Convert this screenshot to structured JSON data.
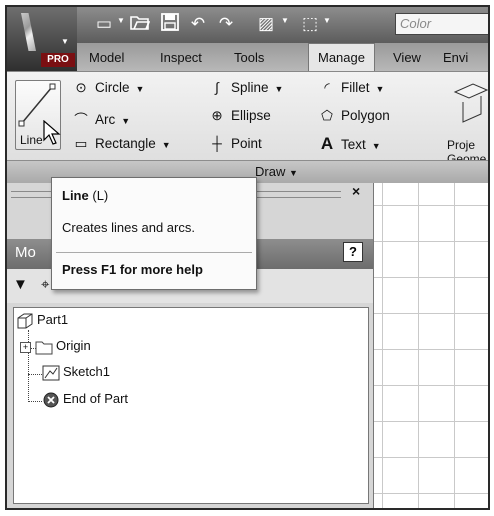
{
  "app": {
    "badge": "PRO",
    "menu_icon": "app-logo-icon"
  },
  "quick_access": {
    "icons": [
      "new-icon",
      "open-icon",
      "save-icon",
      "undo-icon",
      "redo-icon",
      "appearance-icon",
      "select-icon"
    ],
    "color_placeholder": "Color"
  },
  "tabs": [
    {
      "label": "Model"
    },
    {
      "label": "Inspect"
    },
    {
      "label": "Tools"
    },
    {
      "label": "Manage"
    },
    {
      "label": "View"
    },
    {
      "label": "Envi"
    }
  ],
  "ribbon": {
    "line_label": "Line",
    "items": [
      {
        "label": "Circle",
        "icon": "circle-icon",
        "dropdown": true
      },
      {
        "label": "Arc",
        "icon": "arc-icon",
        "dropdown": true
      },
      {
        "label": "Rectangle",
        "icon": "rectangle-icon",
        "dropdown": true
      },
      {
        "label": "Spline",
        "icon": "spline-icon",
        "dropdown": true
      },
      {
        "label": "Ellipse",
        "icon": "ellipse-icon",
        "dropdown": false
      },
      {
        "label": "Point",
        "icon": "point-icon",
        "dropdown": false
      },
      {
        "label": "Fillet",
        "icon": "fillet-icon",
        "dropdown": true
      },
      {
        "label": "Polygon",
        "icon": "polygon-icon",
        "dropdown": false
      },
      {
        "label": "Text",
        "icon": "text-icon",
        "dropdown": true
      }
    ],
    "project_label_1": "Proje",
    "project_label_2": "Geome",
    "panel_title": "Draw"
  },
  "tooltip": {
    "title": "Line",
    "shortcut": "(L)",
    "description": "Creates lines and arcs.",
    "help": "Press F1 for more help"
  },
  "browser": {
    "header": "Mo",
    "help_label": "?",
    "close_label": "×",
    "tree": [
      {
        "label": "Part1",
        "icon": "part-icon"
      },
      {
        "label": "Origin",
        "icon": "folder-icon",
        "expander": "+"
      },
      {
        "label": "Sketch1",
        "icon": "sketch-icon"
      },
      {
        "label": "End of Part",
        "icon": "end-of-part-icon"
      }
    ]
  }
}
